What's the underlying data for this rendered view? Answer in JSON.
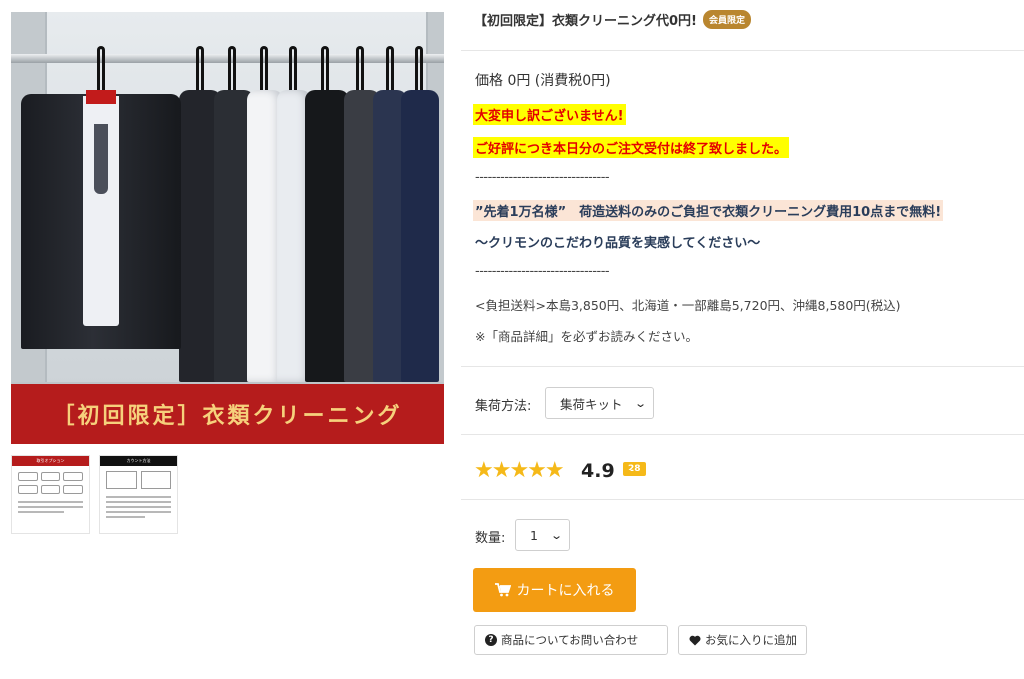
{
  "gallery": {
    "banner_text": "［初回限定］衣類クリーニング",
    "thumb1_header": "取引オプション",
    "thumb2_header": "カウント方法"
  },
  "product": {
    "title": "【初回限定】衣類クリーニング代0円!",
    "member_badge": "会員限定",
    "price": "価格 0円 (消費税0円)"
  },
  "notices": {
    "sorry": "大変申し訳ございません!",
    "sold_out": "ご好評につき本日分のご注文受付は終了致しました。",
    "dashes_1": "--------------------------------",
    "offer": "”先着1万名様”　荷造送料のみのご負担で衣類クリーニング費用10点まで無料!",
    "quality": "〜クリモンのこだわり品質を実感してください〜",
    "dashes_2": "--------------------------------",
    "shipping": "<負担送料>本島3,850円、北海道・一部離島5,720円、沖縄8,580円(税込)",
    "read_details": "※「商品詳細」を必ずお読みください。"
  },
  "options": {
    "pickup_label": "集荷方法:",
    "pickup_value": "集荷キット",
    "quantity_label": "数量:",
    "quantity_value": "1"
  },
  "rating": {
    "stars": "★★★★★",
    "value": "4.9",
    "review_count": "28",
    "star_color": "#f5b919"
  },
  "actions": {
    "cart_label": "カートに入れる",
    "inquiry_label": "商品についてお問い合わせ",
    "favorite_label": "お気に入りに追加",
    "cart_color": "#f39c12"
  },
  "icons": {
    "cart": "cart-icon",
    "question": "question-circle-icon",
    "heart": "heart-icon",
    "chevron": "chevron-down-icon"
  }
}
